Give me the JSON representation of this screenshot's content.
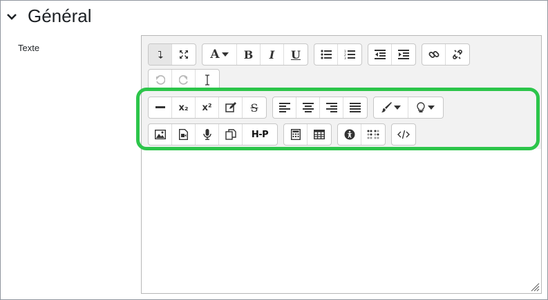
{
  "section": {
    "title": "Général",
    "icon": "chevron-down-icon"
  },
  "field": {
    "label": "Texte"
  },
  "toolbar": {
    "subscript_label": "x₂",
    "superscript_label": "x²",
    "h5p_label": "H-P"
  },
  "highlight_color": "#2cc54a"
}
